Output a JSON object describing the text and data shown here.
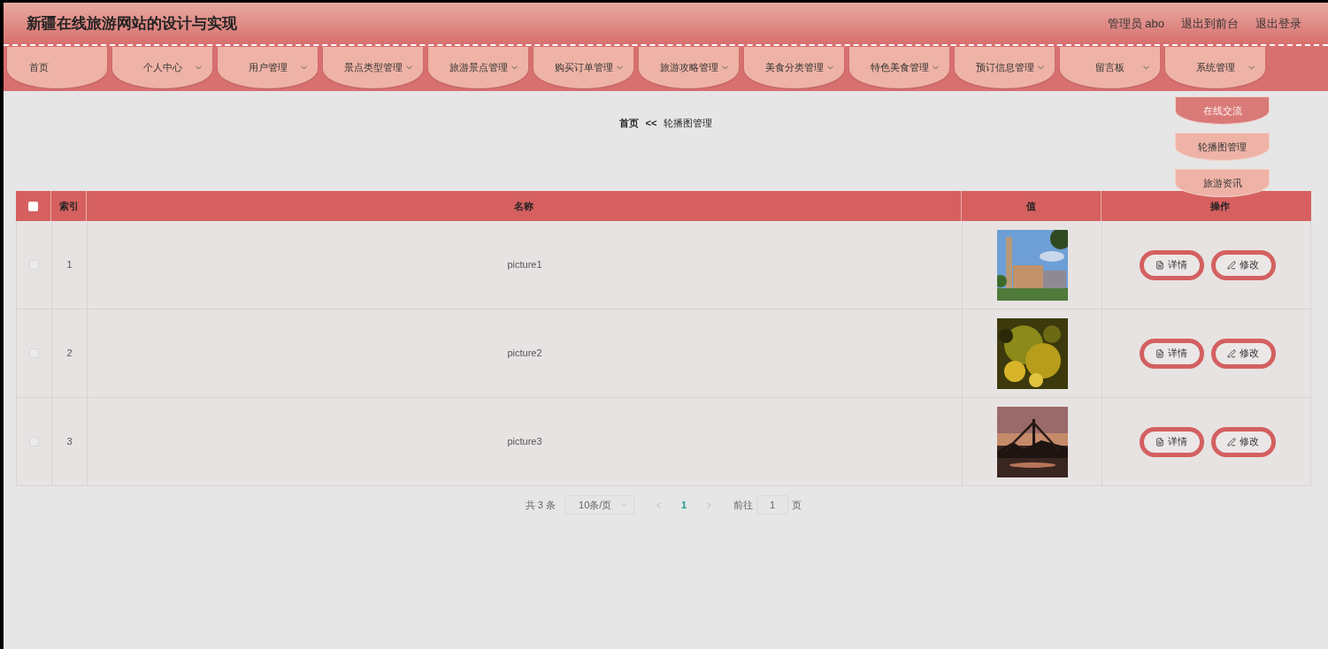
{
  "header": {
    "title": "新疆在线旅游网站的设计与实现",
    "links": [
      "管理员 abo",
      "退出到前台",
      "退出登录"
    ]
  },
  "nav": [
    {
      "label": "首页",
      "dropdown": false
    },
    {
      "label": "个人中心",
      "dropdown": true
    },
    {
      "label": "用户管理",
      "dropdown": true
    },
    {
      "label": "景点类型管理",
      "dropdown": true
    },
    {
      "label": "旅游景点管理",
      "dropdown": true
    },
    {
      "label": "购买订单管理",
      "dropdown": true
    },
    {
      "label": "旅游攻略管理",
      "dropdown": true
    },
    {
      "label": "美食分类管理",
      "dropdown": true
    },
    {
      "label": "特色美食管理",
      "dropdown": true
    },
    {
      "label": "预订信息管理",
      "dropdown": true
    },
    {
      "label": "留言板",
      "dropdown": true
    },
    {
      "label": "系统管理",
      "dropdown": true
    }
  ],
  "dropdown": [
    {
      "label": "在线交流",
      "highlighted": true
    },
    {
      "label": "轮播图管理",
      "highlighted": false
    },
    {
      "label": "旅游资讯",
      "highlighted": false
    }
  ],
  "breadcrumb": {
    "home": "首页",
    "separator": "<<",
    "current": "轮播图管理"
  },
  "table": {
    "select_all_checked": false,
    "columns": [
      "索引",
      "名称",
      "值",
      "操作"
    ],
    "rows": [
      {
        "checked": false,
        "index": "1",
        "name": "picture1",
        "value": {
          "kind": "picture"
        },
        "actions": [
          {
            "kind": "detail",
            "label": "详情"
          },
          {
            "kind": "edit",
            "label": "修改"
          }
        ]
      },
      {
        "checked": false,
        "index": "2",
        "name": "picture2",
        "value": {
          "kind": "picture"
        },
        "actions": [
          {
            "kind": "detail",
            "label": "详情"
          },
          {
            "kind": "edit",
            "label": "修改"
          }
        ]
      },
      {
        "checked": false,
        "index": "3",
        "name": "picture3",
        "value": {
          "kind": "picture"
        },
        "actions": [
          {
            "kind": "detail",
            "label": "详情"
          },
          {
            "kind": "edit",
            "label": "修改"
          }
        ]
      }
    ]
  },
  "pagination": {
    "total": "共 3 条",
    "page_size": "10条/页",
    "pages": [
      {
        "label": "1",
        "selected": true
      }
    ],
    "goto_label": "前往",
    "goto_value": "1",
    "page_suffix": "页"
  }
}
